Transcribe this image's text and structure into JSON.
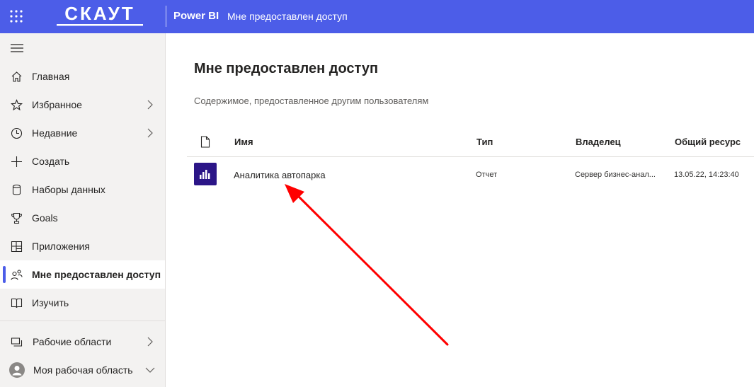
{
  "topbar": {
    "logo_text": "СКАУТ",
    "app_name": "Power BI",
    "page_crumb": "Мне предоставлен доступ"
  },
  "sidebar": {
    "items": [
      {
        "label": "Главная",
        "icon": "home-icon"
      },
      {
        "label": "Избранное",
        "icon": "star-icon",
        "has_chevron": true
      },
      {
        "label": "Недавние",
        "icon": "clock-icon",
        "has_chevron": true
      },
      {
        "label": "Создать",
        "icon": "plus-icon"
      },
      {
        "label": "Наборы данных",
        "icon": "database-icon"
      },
      {
        "label": "Goals",
        "icon": "trophy-icon"
      },
      {
        "label": "Приложения",
        "icon": "apps-icon"
      },
      {
        "label": "Мне предоставлен доступ",
        "icon": "shared-users-icon",
        "active": true
      },
      {
        "label": "Изучить",
        "icon": "book-icon"
      }
    ],
    "workspaces_label": "Рабочие области",
    "my_workspace_label": "Моя рабочая область"
  },
  "main": {
    "title": "Мне предоставлен доступ",
    "subtitle": "Содержимое, предоставленное другим пользователям",
    "columns": [
      "Имя",
      "Тип",
      "Владелец",
      "Общий ресурс"
    ],
    "rows": [
      {
        "name": "Аналитика автопарка",
        "type": "Отчет",
        "owner": "Сервер бизнес-анал...",
        "shared": "13.05.22, 14:23:40"
      }
    ]
  },
  "colors": {
    "accent": "#4c5de8",
    "report_tile": "#2b1587",
    "annotation_arrow": "#ff0000"
  }
}
